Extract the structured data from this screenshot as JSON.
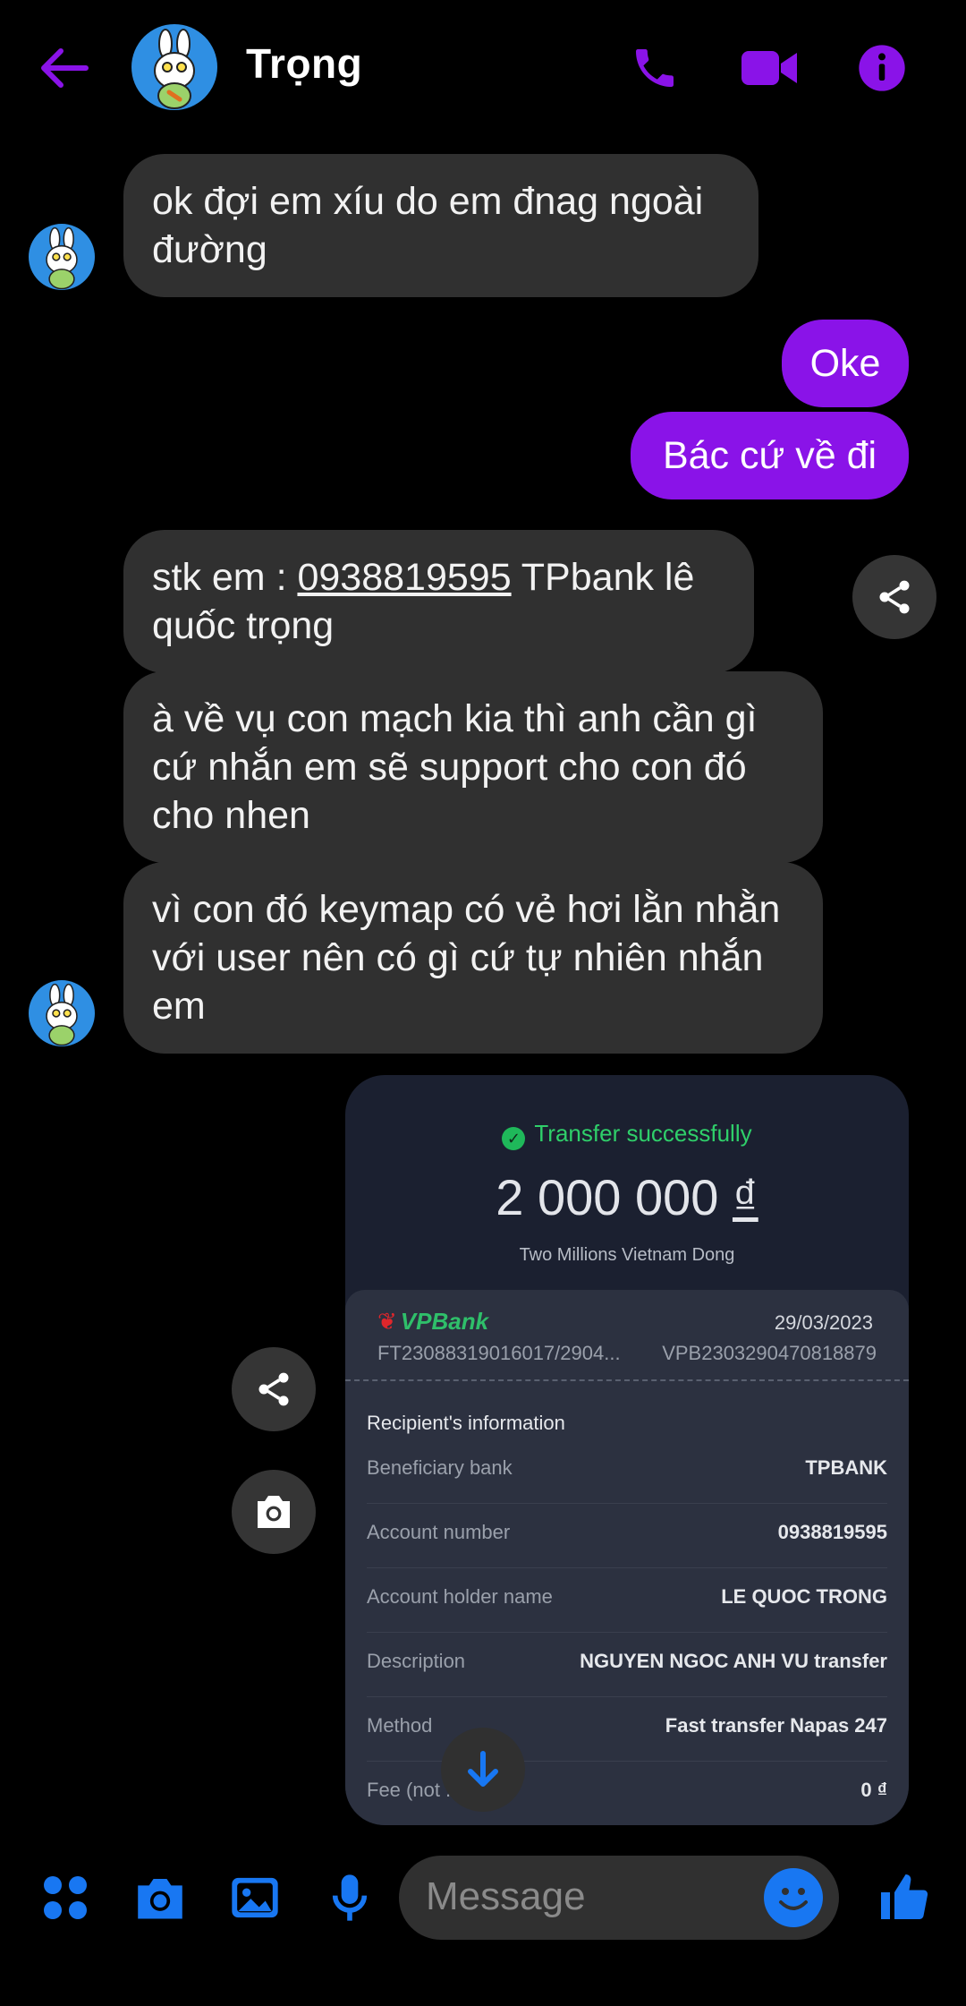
{
  "header": {
    "contact_name": "Trọng",
    "icons": [
      "back-arrow-icon",
      "phone-icon",
      "video-icon",
      "info-icon"
    ],
    "accent_color": "#8A13E8"
  },
  "messages": {
    "m1": "ok đợi em xíu do em đnag ngoài đường",
    "m2": "Oke",
    "m3": "Bác cứ về đi",
    "m4_prefix": "stk em : ",
    "m4_number": "0938819595",
    "m4_suffix": " TPbank lê quốc trọng",
    "m5": "à về vụ con mạch kia thì anh cần gì cứ nhắn em sẽ support cho con đó cho nhen",
    "m6": "vì con đó keymap có vẻ hơi lằn nhằn với user nên có gì cứ tự nhiên nhắn em"
  },
  "receipt": {
    "status": "Transfer successfully",
    "amount": "2 000 000",
    "currency": "₫",
    "amount_words": "Two Millions Vietnam Dong",
    "bank_logo": "VPBank",
    "date": "29/03/2023",
    "ref1": "FT23088319016017/2904...",
    "ref2": "VPB2303290470818879",
    "section_title": "Recipient's information",
    "rows": [
      {
        "label": "Beneficiary bank",
        "value": "TPBANK"
      },
      {
        "label": "Account number",
        "value": "0938819595"
      },
      {
        "label": "Account holder name",
        "value": "LE QUOC TRONG"
      },
      {
        "label": "Description",
        "value": "NGUYEN NGOC ANH VU transfer"
      },
      {
        "label": "Method",
        "value": "Fast transfer Napas 247"
      },
      {
        "label": "Fee (not ... VAT)",
        "value": "0 ₫"
      }
    ]
  },
  "composer": {
    "placeholder": "Message",
    "icons": [
      "apps-icon",
      "camera-icon",
      "gallery-icon",
      "mic-icon",
      "emoji-icon",
      "thumbs-up-icon"
    ],
    "icon_color": "#1877F2"
  }
}
